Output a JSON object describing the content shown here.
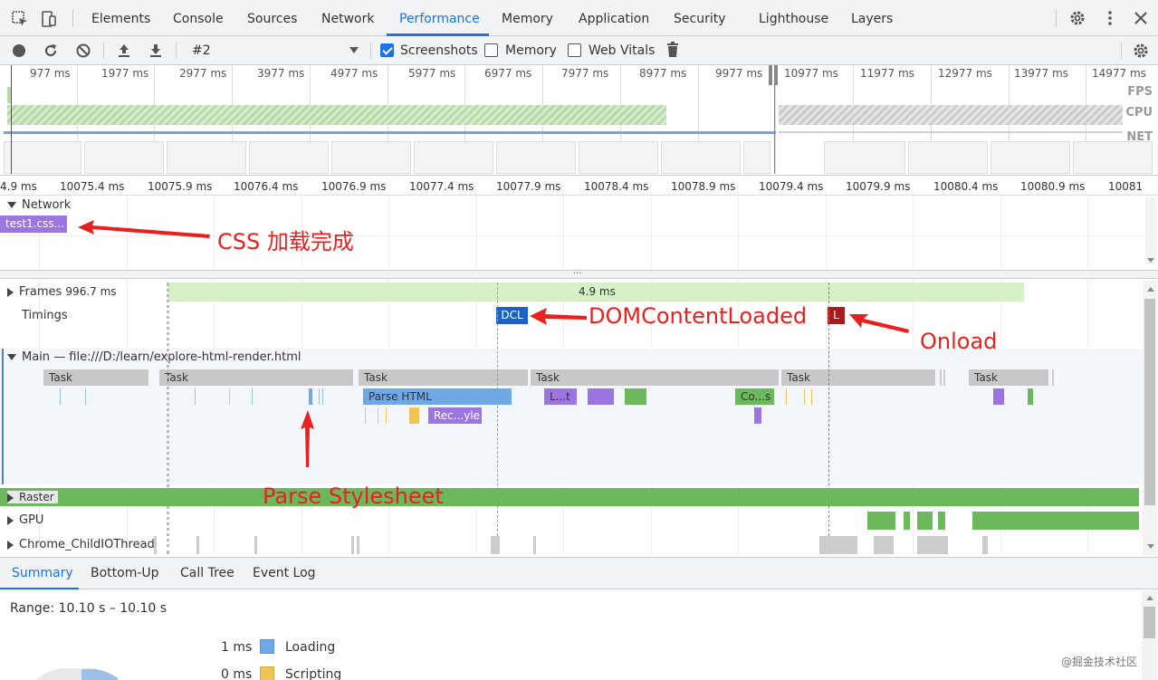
{
  "tabs": [
    {
      "label": "Elements"
    },
    {
      "label": "Console"
    },
    {
      "label": "Sources"
    },
    {
      "label": "Network"
    },
    {
      "label": "Performance",
      "active": true
    },
    {
      "label": "Memory"
    },
    {
      "label": "Application"
    },
    {
      "label": "Security"
    },
    {
      "label": "Lighthouse"
    },
    {
      "label": "Layers"
    }
  ],
  "toolbar": {
    "recording": "#2",
    "screenshots_label": "Screenshots",
    "screenshots_checked": true,
    "memory_label": "Memory",
    "memory_checked": false,
    "webvitals_label": "Web Vitals",
    "webvitals_checked": false
  },
  "overview": {
    "ticks": [
      "977 ms",
      "1977 ms",
      "2977 ms",
      "3977 ms",
      "4977 ms",
      "5977 ms",
      "6977 ms",
      "7977 ms",
      "8977 ms",
      "9977 ms",
      "10977 ms",
      "11977 ms",
      "12977 ms",
      "13977 ms",
      "14977 ms"
    ],
    "labels": {
      "fps": "FPS",
      "cpu": "CPU",
      "net": "NET"
    }
  },
  "ruler": {
    "ticks": [
      "4.9 ms",
      "10075.4 ms",
      "10075.9 ms",
      "10076.4 ms",
      "10076.9 ms",
      "10077.4 ms",
      "10077.9 ms",
      "10078.4 ms",
      "10078.9 ms",
      "10079.4 ms",
      "10079.9 ms",
      "10080.4 ms",
      "10080.9 ms",
      "10081"
    ]
  },
  "network": {
    "label": "Network",
    "request": "test1.css..."
  },
  "tracks": {
    "frames_label": "Frames",
    "frames_value": "996.7 ms",
    "frame_bar": "4.9 ms",
    "timings_label": "Timings",
    "dcl": "DCL",
    "load": "L",
    "main_label": "Main — file:///D:/learn/explore-html-render.html",
    "raster_label": "Raster",
    "gpu_label": "GPU",
    "child_io_label": "Chrome_ChildIOThread"
  },
  "main": {
    "task_label": "Task",
    "parse_html": "Parse HTML",
    "layout": "L...t",
    "composite": "Co...s",
    "recalc": "Rec...yle"
  },
  "annotations": {
    "css_loaded": "CSS 加载完成",
    "dcl": "DOMContentLoaded",
    "onload": "Onload",
    "parse_stylesheet": "Parse Stylesheet"
  },
  "bottom_tabs": [
    {
      "label": "Summary",
      "active": true
    },
    {
      "label": "Bottom-Up"
    },
    {
      "label": "Call Tree"
    },
    {
      "label": "Event Log"
    }
  ],
  "summary": {
    "range": "Range: 10.10 s – 10.10 s",
    "rows": [
      {
        "value": "1 ms",
        "label": "Loading",
        "color": "#6fa8e6"
      },
      {
        "value": "0 ms",
        "label": "Scripting",
        "color": "#f0c357"
      }
    ]
  },
  "watermark": "@掘金技术社区"
}
